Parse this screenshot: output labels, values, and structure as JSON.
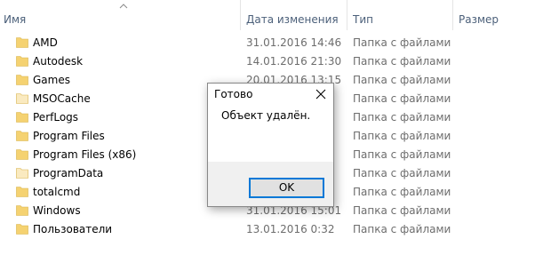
{
  "columns": {
    "name": "Имя",
    "date": "Дата изменения",
    "type": "Тип",
    "size": "Размер"
  },
  "files": [
    {
      "name": "AMD",
      "date": "31.01.2016 14:46",
      "type": "Папка с файлами",
      "icon": "folder-icon"
    },
    {
      "name": "Autodesk",
      "date": "14.01.2016 21:30",
      "type": "Папка с файлами",
      "icon": "folder-icon"
    },
    {
      "name": "Games",
      "date": "20.01.2016 13:15",
      "type": "Папка с файлами",
      "icon": "folder-icon"
    },
    {
      "name": "MSOCache",
      "date": "",
      "type": "Папка с файлами",
      "icon": "folder-hidden-icon"
    },
    {
      "name": "PerfLogs",
      "date": "",
      "type": "Папка с файлами",
      "icon": "folder-icon"
    },
    {
      "name": "Program Files",
      "date": "",
      "type": "Папка с файлами",
      "icon": "folder-icon"
    },
    {
      "name": "Program Files (x86)",
      "date": "",
      "type": "Папка с файлами",
      "icon": "folder-icon"
    },
    {
      "name": "ProgramData",
      "date": "",
      "type": "Папка с файлами",
      "icon": "folder-hidden-icon"
    },
    {
      "name": "totalcmd",
      "date": "",
      "type": "Папка с файлами",
      "icon": "folder-icon"
    },
    {
      "name": "Windows",
      "date": "31.01.2016 15:01",
      "type": "Папка с файлами",
      "icon": "folder-icon"
    },
    {
      "name": "Пользователи",
      "date": "13.01.2016 0:32",
      "type": "Папка с файлами",
      "icon": "folder-icon"
    }
  ],
  "dialog": {
    "title": "Готово",
    "message": "Объект удалён.",
    "ok_label": "OK"
  },
  "colors": {
    "folder": "#f5d271",
    "folder_hidden": "#faeac0",
    "header_text": "#4c607a",
    "accent": "#0078d7"
  }
}
